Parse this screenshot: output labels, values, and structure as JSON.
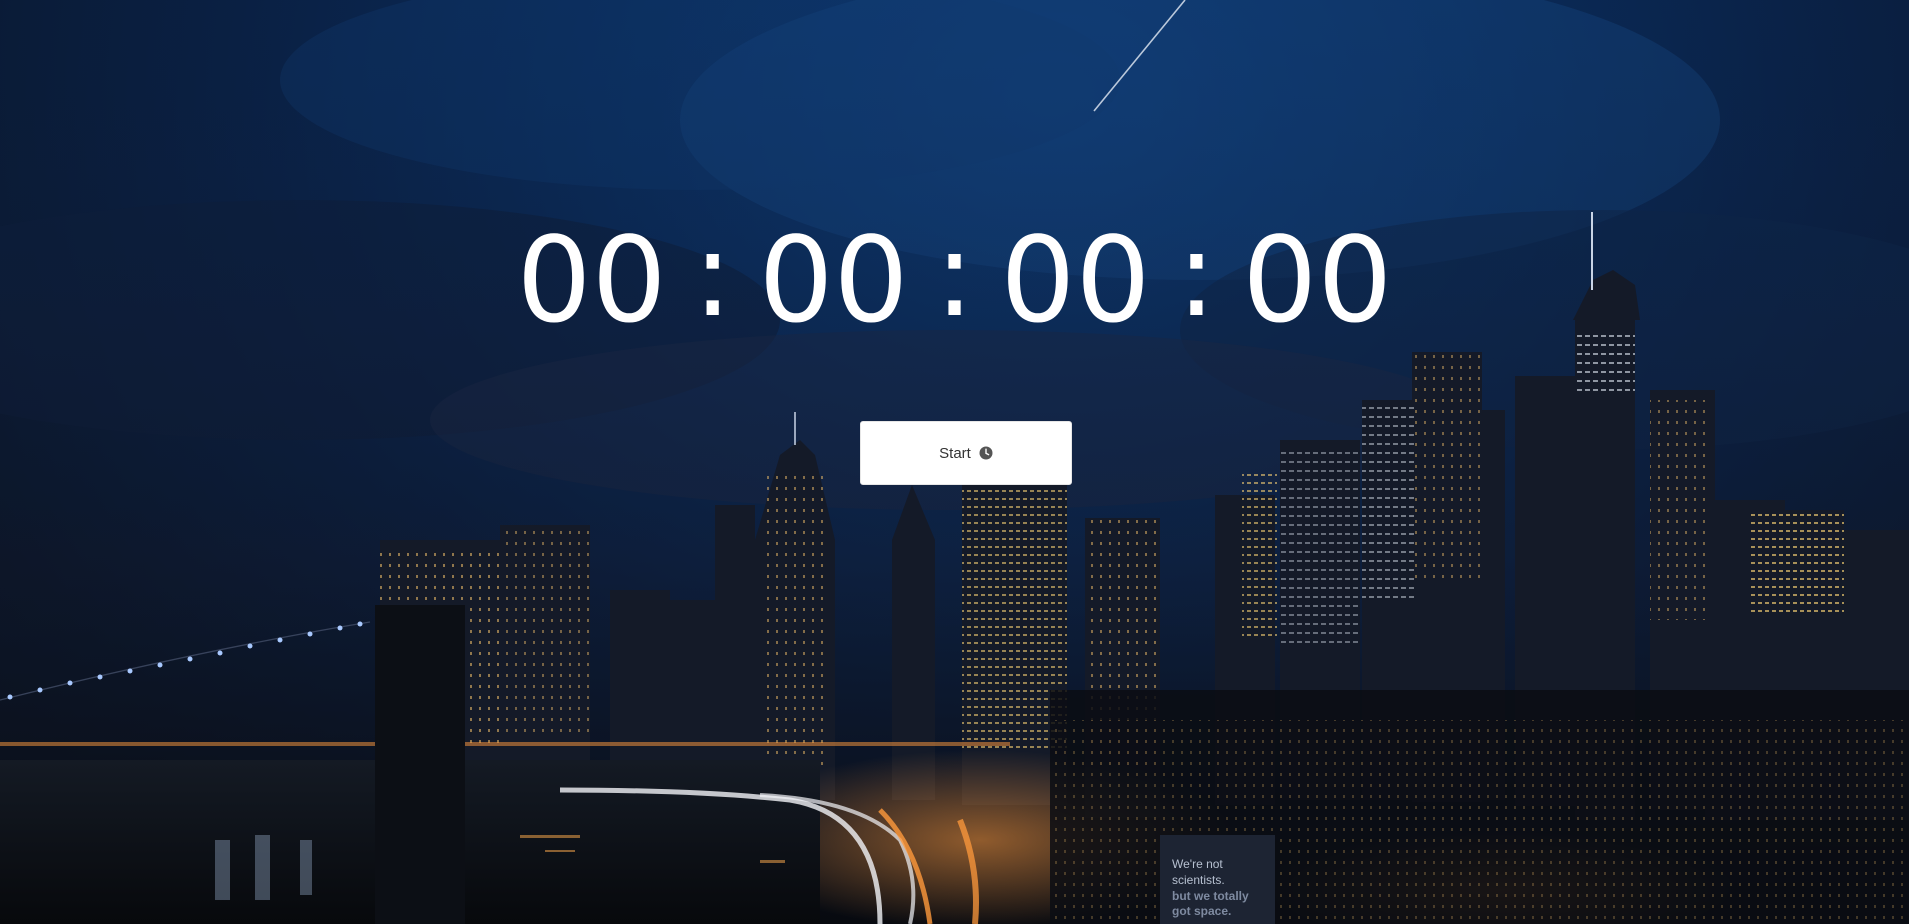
{
  "timer": {
    "days": "00",
    "hours": "00",
    "minutes": "00",
    "seconds": "00",
    "separator": ":"
  },
  "start_button": {
    "label": "Start",
    "icon": "clock-icon"
  },
  "background": {
    "scene": "city-skyline-at-night",
    "billboard_text": [
      "We're not",
      "scientists.",
      "but we totally",
      "got space."
    ]
  },
  "colors": {
    "sky_top": "#0e3a73",
    "sky_dark": "#0a0f1a",
    "timer_text": "#ffffff",
    "button_bg": "#ffffff",
    "button_text": "#333333"
  }
}
